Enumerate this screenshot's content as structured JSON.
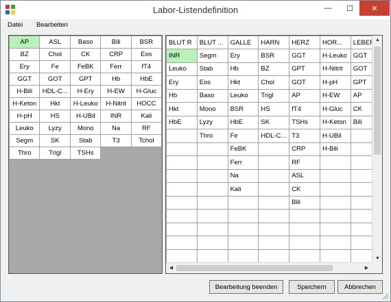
{
  "window": {
    "title": "Labor-Listendefinition",
    "min": "—",
    "max": "☐",
    "close": "✕"
  },
  "menu": [
    "Datei",
    "Bearbeiten"
  ],
  "left_grid": [
    [
      "AP",
      "ASL",
      "Baso",
      "Bili",
      "BSR"
    ],
    [
      "BZ",
      "Chol",
      "CK",
      "CRP",
      "Eos"
    ],
    [
      "Ery",
      "Fe",
      "FeBK",
      "Ferr",
      "fT4"
    ],
    [
      "GGT",
      "GOT",
      "GPT",
      "Hb",
      "HbE"
    ],
    [
      "H-Bili",
      "HDL-C...",
      "H-Ery",
      "H-EW",
      "H-Gluc"
    ],
    [
      "H-Keton",
      "Hkt",
      "H-Leuko",
      "H-Nitrit",
      "HOCC"
    ],
    [
      "H-pH",
      "HS",
      "H-UBil",
      "INR",
      "Kali"
    ],
    [
      "Leuko",
      "Lyzy",
      "Mono",
      "Na",
      "RF"
    ],
    [
      "Segm",
      "SK",
      "Stab",
      "T3",
      "Tchol"
    ],
    [
      "Thro",
      "Trigl",
      "TSHs",
      "",
      ""
    ]
  ],
  "right_columns": [
    "BLUT R",
    "BLUT ...",
    "GALLE",
    "HARN",
    "HERZ",
    "HOR...",
    "LEBER"
  ],
  "right_rows": [
    [
      "INR",
      "Segm",
      "Ery",
      "BSR",
      "GGT",
      "H-Leuko",
      "GGT"
    ],
    [
      "Leuko",
      "Stab",
      "Hb",
      "BZ",
      "GPT",
      "H-Nitrit",
      "GOT"
    ],
    [
      "Ery",
      "Eos",
      "Hkt",
      "Chol",
      "GOT",
      "H-pH",
      "GPT"
    ],
    [
      "Hb",
      "Baso",
      "Leuko",
      "Trigl",
      "AP",
      "H-EW",
      "AP"
    ],
    [
      "Hkt",
      "Mono",
      "BSR",
      "HS",
      "fT4",
      "H-Gluc",
      "CK"
    ],
    [
      "HbE",
      "Lyzy",
      "HbE",
      "SK",
      "TSHs",
      "H-Keton",
      "Bili"
    ],
    [
      "",
      "Thro",
      "Fe",
      "HDL-C...",
      "T3",
      "H-UBil",
      ""
    ],
    [
      "",
      "",
      "FeBK",
      "",
      "CRP",
      "H-Bili",
      ""
    ],
    [
      "",
      "",
      "Ferr",
      "",
      "RF",
      "",
      ""
    ],
    [
      "",
      "",
      "Na",
      "",
      "ASL",
      "",
      ""
    ],
    [
      "",
      "",
      "Kali",
      "",
      "CK",
      "",
      ""
    ],
    [
      "",
      "",
      "",
      "",
      "Bili",
      "",
      ""
    ],
    [
      "",
      "",
      "",
      "",
      "",
      "",
      ""
    ],
    [
      "",
      "",
      "",
      "",
      "",
      "",
      ""
    ],
    [
      "",
      "",
      "",
      "",
      "",
      "",
      ""
    ],
    [
      "",
      "",
      "",
      "",
      "",
      "",
      ""
    ]
  ],
  "buttons": {
    "finish": "Bearbeitung beenden",
    "save": "Speichern",
    "cancel": "Abbrechen"
  },
  "colors": {
    "selected_cell": "#b9f2b9",
    "close_button": "#c84031"
  }
}
